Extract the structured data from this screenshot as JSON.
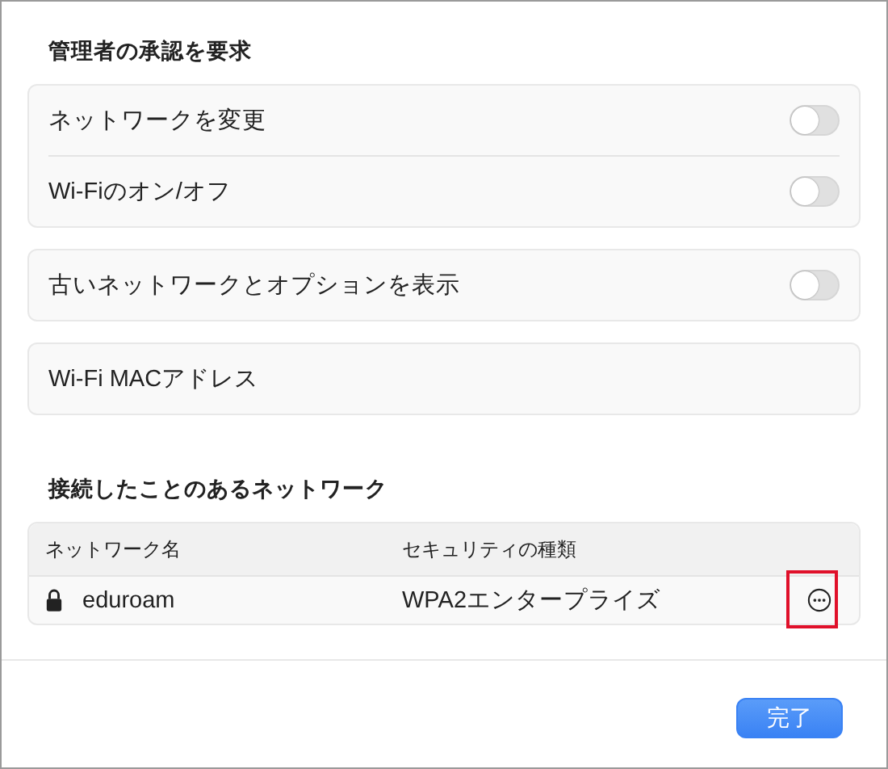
{
  "sections": [
    {
      "title": "管理者の承認を要求",
      "groups": [
        {
          "rows": [
            {
              "kind": "toggle",
              "label": "ネットワークを変更",
              "on": false
            },
            {
              "kind": "toggle",
              "label": "Wi-Fiのオン/オフ",
              "on": false
            }
          ]
        },
        {
          "rows": [
            {
              "kind": "toggle",
              "label": "古いネットワークとオプションを表示",
              "on": false
            }
          ]
        },
        {
          "rows": [
            {
              "kind": "plain",
              "label": "Wi-Fi MACアドレス"
            }
          ]
        }
      ]
    }
  ],
  "known_networks": {
    "title": "接続したことのあるネットワーク",
    "columns": [
      "ネットワーク名",
      "セキュリティの種類"
    ],
    "rows": [
      {
        "name": "eduroam",
        "locked": true,
        "security": "WPA2エンタープライズ",
        "more_highlighted": true
      }
    ]
  },
  "buttons": [
    {
      "label": "完了",
      "primary": true
    }
  ]
}
